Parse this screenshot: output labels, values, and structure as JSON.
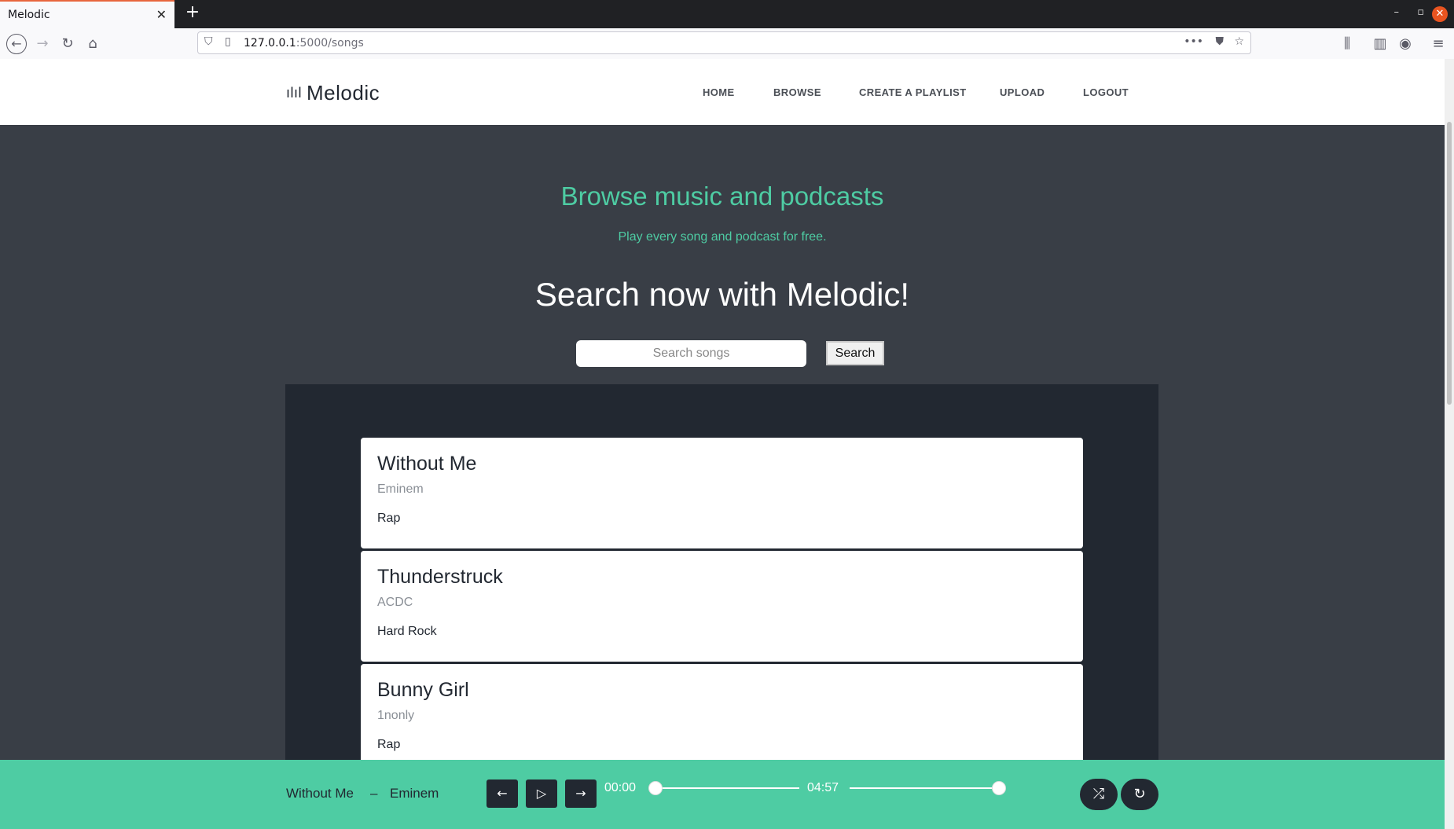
{
  "browser": {
    "tab_title": "Melodic",
    "tab_close": "✕",
    "new_tab": "+",
    "url_host": "127.0.0.1",
    "url_path": ":5000/songs",
    "win_min": "–",
    "win_max": "▫",
    "win_close": "✕"
  },
  "site": {
    "logo": "Melodic",
    "nav": [
      "HOME",
      "BROWSE",
      "CREATE A PLAYLIST",
      "UPLOAD",
      "LOGOUT"
    ]
  },
  "hero": {
    "title": "Browse music and podcasts",
    "subtitle": "Play every song and podcast for free."
  },
  "search": {
    "title": "Search now with Melodic!",
    "placeholder": "Search songs",
    "button": "Search"
  },
  "songs": [
    {
      "title": "Without Me",
      "artist": "Eminem",
      "genre": "Rap"
    },
    {
      "title": "Thunderstruck",
      "artist": "ACDC",
      "genre": "Hard Rock"
    },
    {
      "title": "Bunny Girl",
      "artist": "1nonly",
      "genre": "Rap"
    }
  ],
  "player": {
    "title": "Without Me",
    "separator": "–",
    "artist": "Eminem",
    "current_time": "00:00",
    "duration": "04:57",
    "progress": 0,
    "volume": 1,
    "prev_icon": "←",
    "play_icon": "▷",
    "next_icon": "→",
    "shuffle_icon": "⤮",
    "repeat_icon": "↻"
  },
  "colors": {
    "accent": "#4ecca3",
    "page_bg": "#393e46",
    "dark": "#222831"
  }
}
